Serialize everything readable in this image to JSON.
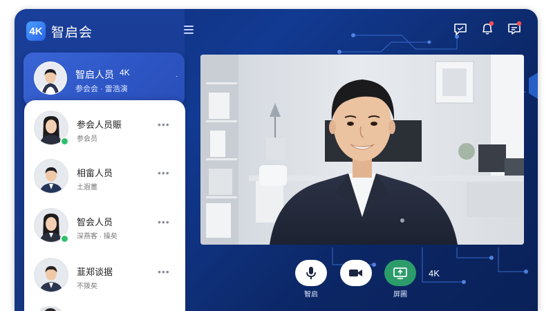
{
  "app": {
    "logo_text": "4K",
    "name": "智启会"
  },
  "active_participant": {
    "name": "智启人员",
    "badge": "4K",
    "subtitle": "参会会 · 雷浩演",
    "dot": "·"
  },
  "participants": [
    {
      "name": "参会人员賑",
      "subtitle": "参会员",
      "more": "•••",
      "online": true
    },
    {
      "name": "相畲人员",
      "subtitle": "土遐薑",
      "more": "•••",
      "online": false
    },
    {
      "name": "智会人员",
      "subtitle": "深燕客 · 操矣",
      "more": "•••",
      "online": true
    },
    {
      "name": "韮郑谈据",
      "subtitle": "不拨矣",
      "more": "•••",
      "online": false
    }
  ],
  "header_icons": [
    "chat-icon",
    "bell-icon",
    "message-icon"
  ],
  "controls": {
    "mic_label": "智启",
    "camera_label": "",
    "share_label": "屏圖",
    "resolution": "4K"
  },
  "colors": {
    "accent": "#2c9c6a",
    "background": "#0f2e7a",
    "notify": "#ff4d4f"
  }
}
